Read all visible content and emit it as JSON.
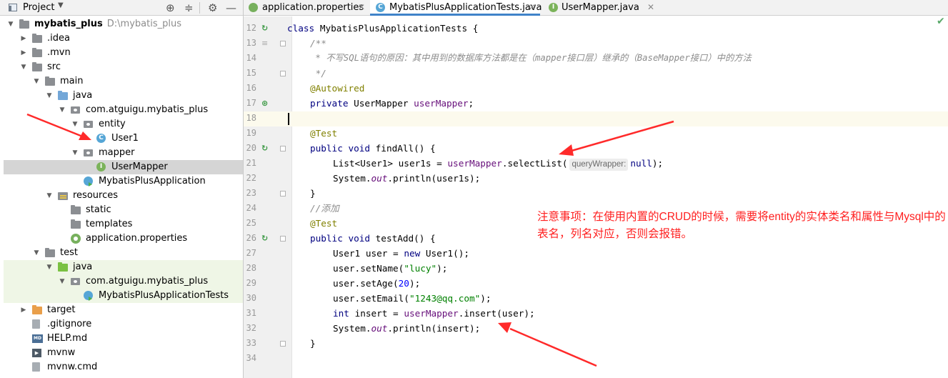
{
  "project_panel": {
    "title": "Project",
    "tree": [
      {
        "label": "mybatis_plus",
        "hint": "D:\\mybatis_plus",
        "depth": 0,
        "expanded": true,
        "icon": "module-folder-icon",
        "bold": true
      },
      {
        "label": ".idea",
        "depth": 1,
        "expanded": false,
        "icon": "folder-icon"
      },
      {
        "label": ".mvn",
        "depth": 1,
        "expanded": false,
        "icon": "folder-icon"
      },
      {
        "label": "src",
        "depth": 1,
        "expanded": true,
        "icon": "folder-icon"
      },
      {
        "label": "main",
        "depth": 2,
        "expanded": true,
        "icon": "folder-icon"
      },
      {
        "label": "java",
        "depth": 3,
        "expanded": true,
        "icon": "source-folder-icon"
      },
      {
        "label": "com.atguigu.mybatis_plus",
        "depth": 4,
        "expanded": true,
        "icon": "package-icon"
      },
      {
        "label": "entity",
        "depth": 5,
        "expanded": true,
        "icon": "package-icon"
      },
      {
        "label": "User1",
        "depth": 6,
        "icon": "class-icon"
      },
      {
        "label": "mapper",
        "depth": 5,
        "expanded": true,
        "icon": "package-icon"
      },
      {
        "label": "UserMapper",
        "depth": 6,
        "icon": "interface-icon",
        "selected": true
      },
      {
        "label": "MybatisPlusApplication",
        "depth": 5,
        "icon": "run-class-icon"
      },
      {
        "label": "resources",
        "depth": 3,
        "expanded": true,
        "icon": "resources-folder-icon"
      },
      {
        "label": "static",
        "depth": 4,
        "icon": "folder-icon"
      },
      {
        "label": "templates",
        "depth": 4,
        "icon": "folder-icon"
      },
      {
        "label": "application.properties",
        "depth": 4,
        "icon": "properties-icon"
      },
      {
        "label": "test",
        "depth": 2,
        "expanded": true,
        "icon": "folder-icon"
      },
      {
        "label": "java",
        "depth": 3,
        "expanded": true,
        "icon": "test-folder-icon",
        "test": true
      },
      {
        "label": "com.atguigu.mybatis_plus",
        "depth": 4,
        "expanded": true,
        "icon": "package-icon",
        "test": true
      },
      {
        "label": "MybatisPlusApplicationTests",
        "depth": 5,
        "icon": "run-class-icon",
        "test": true
      },
      {
        "label": "target",
        "depth": 1,
        "expanded": false,
        "icon": "excluded-folder-icon",
        "excluded": true
      },
      {
        "label": ".gitignore",
        "depth": 1,
        "icon": "file-icon"
      },
      {
        "label": "HELP.md",
        "depth": 1,
        "icon": "markdown-icon"
      },
      {
        "label": "mvnw",
        "depth": 1,
        "icon": "terminal-file-icon"
      },
      {
        "label": "mvnw.cmd",
        "depth": 1,
        "icon": "file-icon"
      }
    ]
  },
  "editor": {
    "tabs": [
      {
        "label": "application.properties",
        "icon": "properties-icon",
        "active": false
      },
      {
        "label": "MybatisPlusApplicationTests.java",
        "icon": "test-class-icon",
        "active": true
      },
      {
        "label": "UserMapper.java",
        "icon": "interface-icon",
        "active": false
      }
    ],
    "line_numbers": [
      "12",
      "13",
      "14",
      "15",
      "16",
      "17",
      "18",
      "19",
      "20",
      "21",
      "22",
      "23",
      "24",
      "25",
      "26",
      "27",
      "28",
      "29",
      "30",
      "31",
      "32",
      "33",
      "34"
    ],
    "code": {
      "l12_kw": "class ",
      "l12_rest": "MybatisPlusApplicationTests {",
      "l13": "/**",
      "l14": " * 不写SQL语句的原因：其中用到的数据库方法都是在（mapper接口层）继承的（BaseMapper接口）中的方法",
      "l15": " */",
      "l16": "@Autowired",
      "l17_kw": "private ",
      "l17_type": "UserMapper ",
      "l17_field": "userMapper",
      "l17_end": ";",
      "l19": "@Test",
      "l20_kw": "public void ",
      "l20_rest": "findAll() {",
      "l21_a": "List<User1> user1s = ",
      "l21_field": "userMapper",
      "l21_b": ".selectList(",
      "l21_hint": "queryWrapper:",
      "l21_null": "null",
      "l21_end": ");",
      "l22_a": "System.",
      "l22_out": "out",
      "l22_b": ".println(user1s);",
      "l23": "}",
      "l24": "//添加",
      "l25": "@Test",
      "l26_kw": "public void ",
      "l26_rest": "testAdd() {",
      "l27_a": "User1 user = ",
      "l27_kw": "new ",
      "l27_b": "User1();",
      "l28_a": "user.setName(",
      "l28_str": "\"lucy\"",
      "l28_b": ");",
      "l29_a": "user.setAge(",
      "l29_num": "20",
      "l29_b": ");",
      "l30_a": "user.setEmail(",
      "l30_str": "\"1243@qq.com\"",
      "l30_b": ");",
      "l31_kw": "int ",
      "l31_a": "insert = ",
      "l31_field": "userMapper",
      "l31_b": ".insert(user);",
      "l32_a": "System.",
      "l32_out": "out",
      "l32_b": ".println(insert);",
      "l33": "}"
    }
  },
  "annotation": {
    "text": "注意事项：在使用内置的CRUD的时候，需要将entity的实体类名和属性与Mysql中的表名，列名对应，否则会报错。",
    "color": "#ff2020"
  },
  "colors": {
    "keyword": "#000080",
    "annotation": "#808000",
    "field": "#660e7a",
    "string": "#008000",
    "number": "#0000ff",
    "comment": "#8c8c8c",
    "selection": "#d5d5d5",
    "test_bg": "#eff6e6",
    "active_tab_underline": "#4083c9"
  }
}
